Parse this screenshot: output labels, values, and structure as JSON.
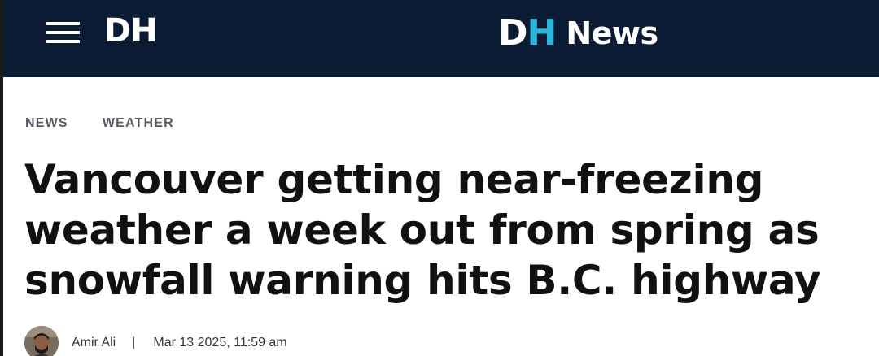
{
  "header": {
    "menu_icon": "hamburger-menu-icon",
    "logo_small": "DH",
    "logo_main_d": "D",
    "logo_main_h": "H",
    "logo_main_word": "News",
    "colors": {
      "background": "#0b1b33",
      "logo_accent": "#2cb5d8",
      "logo_text": "#ffffff"
    }
  },
  "breadcrumb": {
    "items": [
      {
        "label": "NEWS"
      },
      {
        "label": "WEATHER"
      }
    ]
  },
  "article": {
    "headline": "Vancouver getting near-freezing weather a week out from spring as snowfall warning hits B.C. highway",
    "author": "Amir Ali",
    "separator": "|",
    "date": "Mar 13 2025, 11:59 am",
    "avatar_icon": "author-avatar"
  }
}
